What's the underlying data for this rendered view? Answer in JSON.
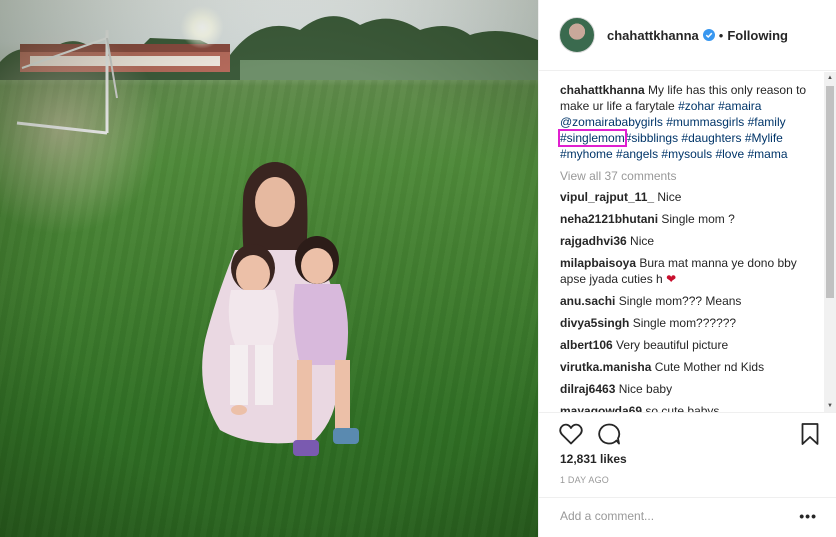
{
  "post": {
    "username": "chahattkhanna",
    "follow_status": "Following",
    "separator": "•",
    "caption": {
      "text": "My life has this only reason to make ur life a farytale",
      "tags": [
        "#zohar",
        "#amaira",
        "@zomairababygirls",
        "#mummasgirls",
        "#family",
        "#singlemom",
        "#sibblings",
        "#daughters",
        "#Mylife",
        "#myhome",
        "#angels",
        "#mysouls",
        "#love",
        "#mama"
      ]
    },
    "view_all": "View all 37 comments",
    "comments": [
      {
        "user": "vipul_rajput_11_",
        "text": "Nice"
      },
      {
        "user": "neha2121bhutani",
        "text": "Single mom ?"
      },
      {
        "user": "rajgadhvi36",
        "text": "Nice"
      },
      {
        "user": "milapbaisoya",
        "text": "Bura mat manna ye dono bby apse jyada cuties h"
      },
      {
        "user": "anu.sachi",
        "text": "Single mom??? Means"
      },
      {
        "user": "divya5singh",
        "text": "Single mom??????"
      },
      {
        "user": "albert106",
        "text": "Very beautiful picture"
      },
      {
        "user": "virutka.manisha",
        "text": "Cute Mother nd Kids"
      },
      {
        "user": "dilraj6463",
        "text": "Nice baby"
      },
      {
        "user": "mayagowda69",
        "text": "so cute babys"
      }
    ],
    "likes": "12,831 likes",
    "date": "1 DAY AGO",
    "add_comment_placeholder": "Add a comment...",
    "more": "•••",
    "heart_emoji": "❤",
    "icons": {
      "like": "heart-outline-icon",
      "comment": "speech-bubble-icon",
      "save": "bookmark-icon",
      "verified": "verified-badge-icon"
    },
    "colors": {
      "link": "#003569",
      "highlight": "#e020d0",
      "muted": "#999999",
      "verified": "#3897f0"
    }
  }
}
